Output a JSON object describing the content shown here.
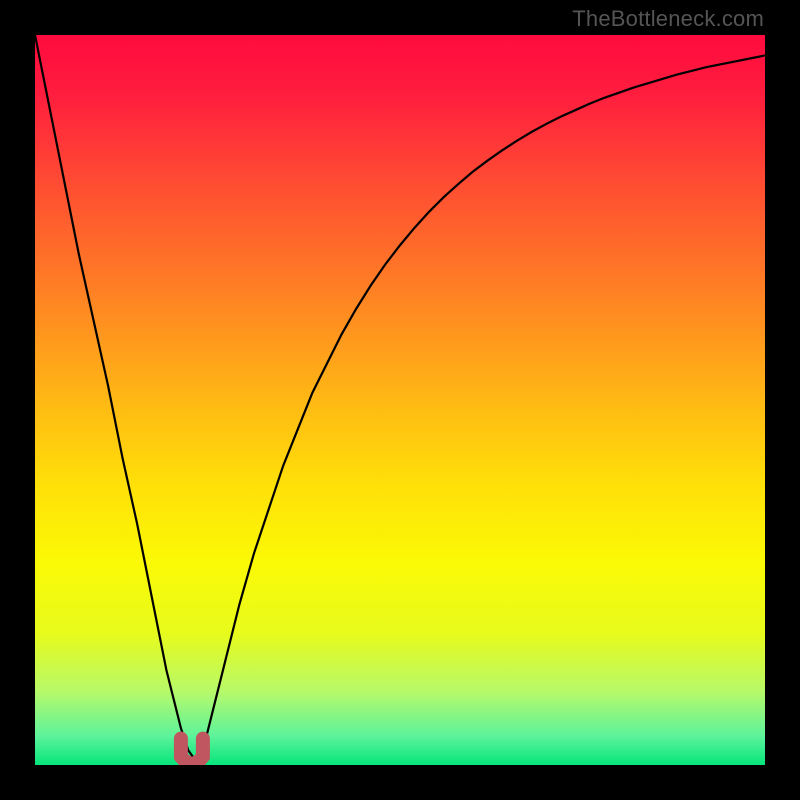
{
  "watermark": "TheBottleneck.com",
  "chart_data": {
    "type": "line",
    "title": "",
    "xlabel": "",
    "ylabel": "",
    "xlim": [
      0,
      100
    ],
    "ylim": [
      0,
      100
    ],
    "x": [
      0,
      2,
      4,
      6,
      8,
      10,
      12,
      14,
      15,
      16,
      17,
      18,
      19,
      20,
      21,
      22,
      23,
      24,
      26,
      28,
      30,
      32,
      34,
      36,
      38,
      40,
      42,
      44,
      46,
      48,
      50,
      52,
      54,
      56,
      58,
      60,
      62,
      64,
      66,
      68,
      70,
      72,
      74,
      76,
      78,
      80,
      82,
      84,
      86,
      88,
      90,
      92,
      94,
      96,
      98,
      100
    ],
    "values": [
      100,
      90,
      80,
      70,
      61,
      52,
      42,
      33,
      28,
      23,
      18,
      13,
      9,
      5,
      2,
      0.6,
      2,
      6,
      14,
      22,
      29,
      35,
      41,
      46,
      51,
      55,
      59,
      62.5,
      65.7,
      68.6,
      71.2,
      73.6,
      75.8,
      77.8,
      79.6,
      81.3,
      82.8,
      84.2,
      85.5,
      86.7,
      87.8,
      88.8,
      89.7,
      90.6,
      91.4,
      92.1,
      92.8,
      93.4,
      94.0,
      94.6,
      95.1,
      95.6,
      96.0,
      96.4,
      96.8,
      97.2
    ],
    "dip": {
      "x_percent": 21.5,
      "y_percent": 0.6
    },
    "gradient_stops": [
      {
        "offset": 0,
        "color": "#ff0b3e"
      },
      {
        "offset": 0.08,
        "color": "#ff1d3e"
      },
      {
        "offset": 0.2,
        "color": "#ff4b33"
      },
      {
        "offset": 0.35,
        "color": "#ff8024"
      },
      {
        "offset": 0.5,
        "color": "#ffb814"
      },
      {
        "offset": 0.62,
        "color": "#ffe108"
      },
      {
        "offset": 0.72,
        "color": "#fbf905"
      },
      {
        "offset": 0.82,
        "color": "#e7fb1c"
      },
      {
        "offset": 0.9,
        "color": "#b6f96a"
      },
      {
        "offset": 0.96,
        "color": "#5df39b"
      },
      {
        "offset": 1.0,
        "color": "#06e57a"
      }
    ],
    "marker_color": "#c0565f",
    "line_color": "#000000"
  }
}
